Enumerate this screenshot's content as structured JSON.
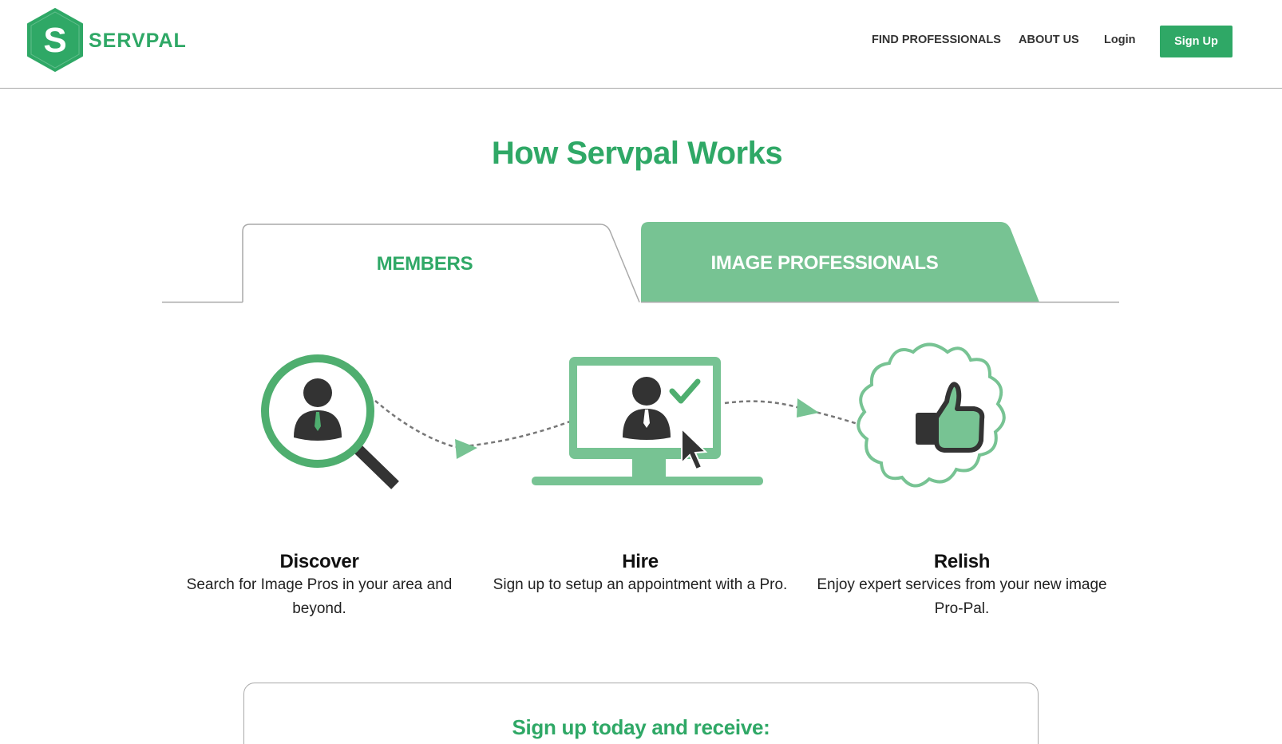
{
  "brand": {
    "logo_letter": "S",
    "name": "SERVPAL",
    "color": "#2fa866",
    "accent_light": "#77c393"
  },
  "nav": {
    "find_professionals": "FIND PROFESSIONALS",
    "about_us": "ABOUT US",
    "login": "Login",
    "sign_up": "Sign Up"
  },
  "main": {
    "title": "How Servpal Works",
    "tabs": [
      {
        "label": "MEMBERS",
        "active": true
      },
      {
        "label": "IMAGE PROFESSIONALS",
        "active": false
      }
    ],
    "steps": [
      {
        "icon": "magnifier-person-icon",
        "title": "Discover",
        "description": "Search for Image Pros in your area and beyond."
      },
      {
        "icon": "monitor-hire-icon",
        "title": "Hire",
        "description": "Sign up to setup an appointment with a Pro."
      },
      {
        "icon": "thumbs-up-badge-icon",
        "title": "Relish",
        "description": "Enjoy expert services from your new image Pro-Pal."
      }
    ],
    "promo": {
      "title": "Sign up today and receive:"
    }
  }
}
